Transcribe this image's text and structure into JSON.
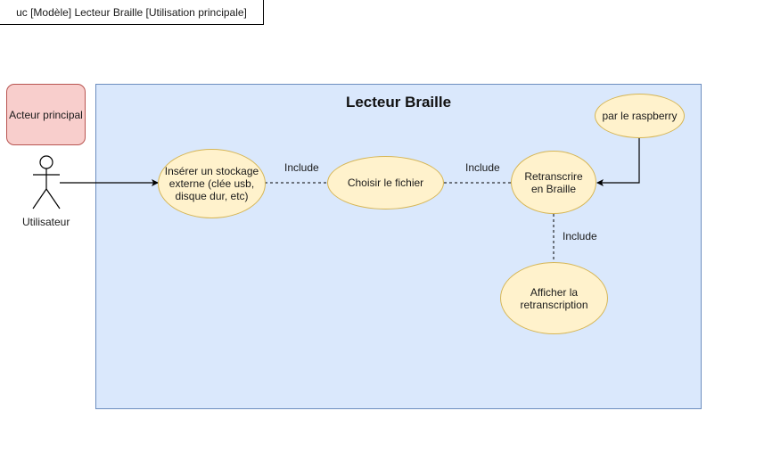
{
  "frame": {
    "label": "uc [Modèle] Lecteur Braille [Utilisation principale]"
  },
  "system": {
    "title": "Lecteur Braille"
  },
  "role_box": {
    "label": "Acteur principal"
  },
  "actor": {
    "name": "Utilisateur"
  },
  "use_cases": {
    "insert_storage": "Insérer un stockage externe (clée usb, disque dur, etc)",
    "choose_file": "Choisir le fichier",
    "transcribe": "Retranscrire en Braille",
    "raspberry": "par le raspberry",
    "display": "Afficher la retranscription"
  },
  "relations": {
    "include_1": "Include",
    "include_2": "Include",
    "include_3": "Include"
  },
  "colors": {
    "system_fill": "#dae8fc",
    "system_stroke": "#6c8ebf",
    "usecase_fill": "#fff2cc",
    "usecase_stroke": "#d6b656",
    "role_fill": "#f8cecc",
    "role_stroke": "#b85450"
  }
}
